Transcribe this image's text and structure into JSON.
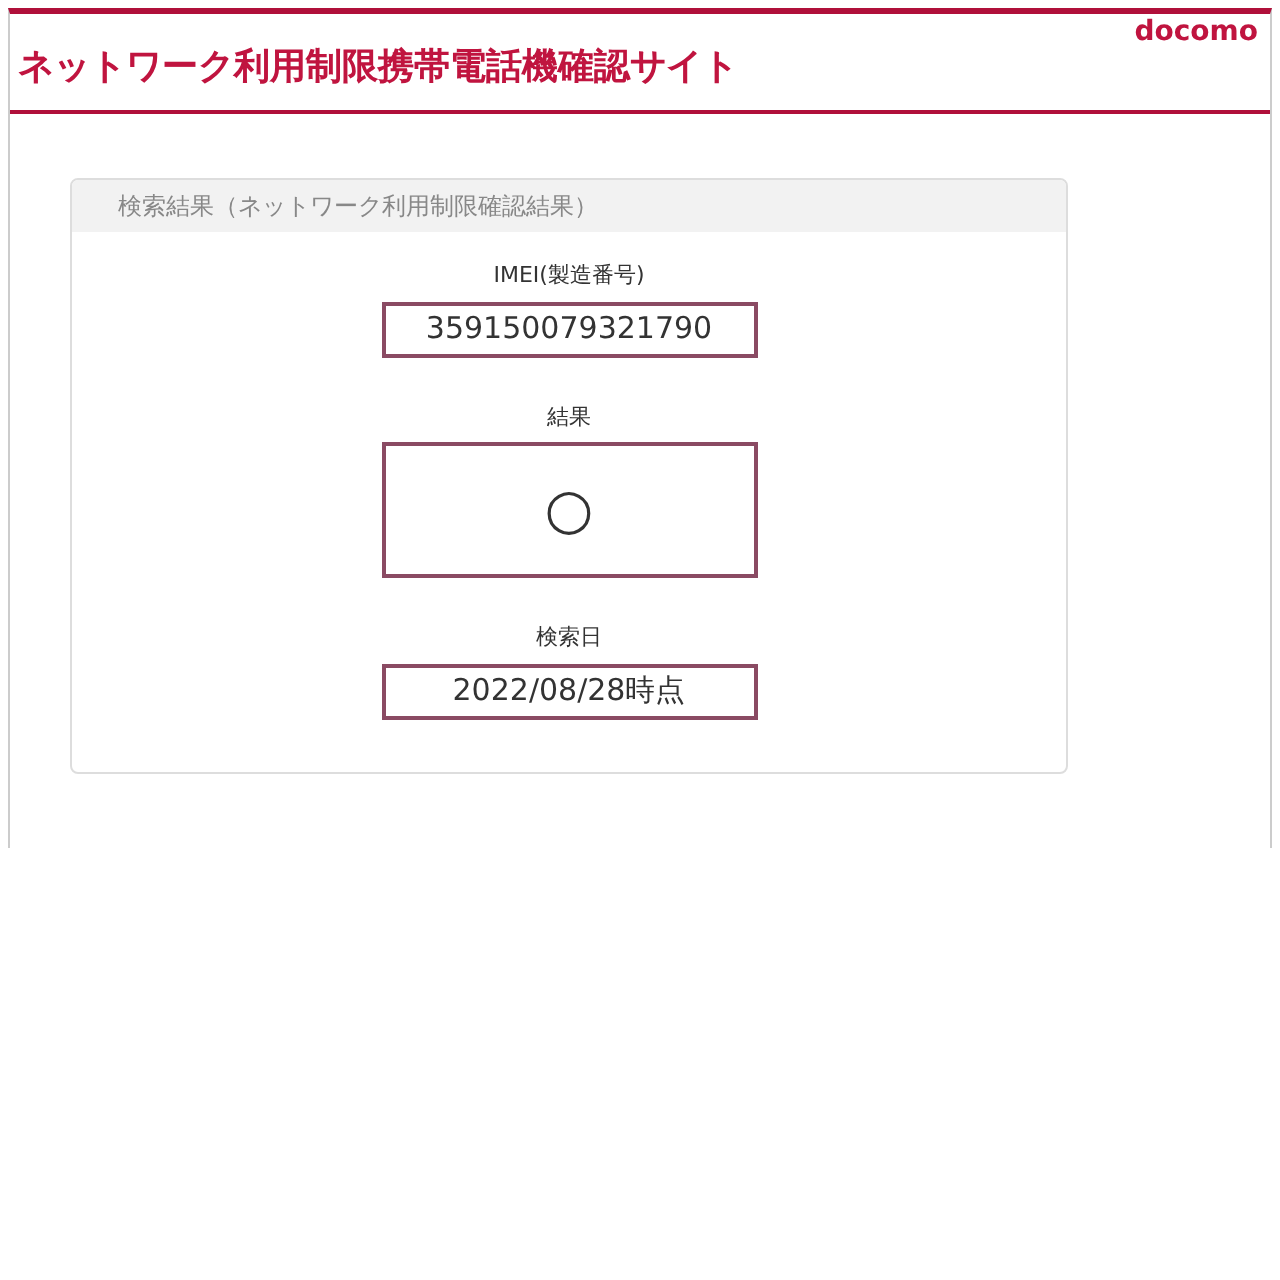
{
  "header": {
    "title": "ネットワーク利用制限携帯電話機確認サイト",
    "logo": "docomo"
  },
  "result_card": {
    "heading": "検索結果（ネットワーク利用制限確認結果）",
    "fields": [
      {
        "label": "IMEI(製造番号)",
        "value": "359150079321790",
        "kind": "text"
      },
      {
        "label": "結果",
        "value": "○",
        "kind": "mark"
      },
      {
        "label": "検索日",
        "value": "2022/08/28時点",
        "kind": "text"
      }
    ]
  }
}
